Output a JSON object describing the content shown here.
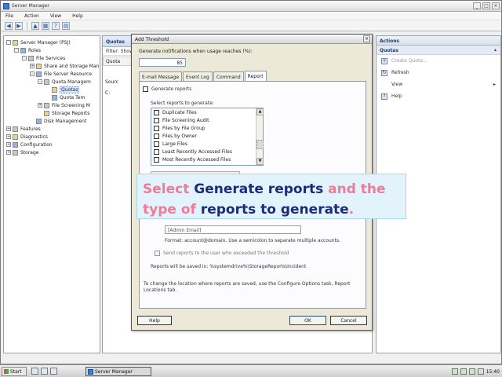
{
  "window": {
    "title": "Server Manager"
  },
  "menu": [
    "File",
    "Action",
    "View",
    "Help"
  ],
  "tree": [
    {
      "label": "Server Manager (PSJ)",
      "depth": 0,
      "exp": "-",
      "icon": "server-icon"
    },
    {
      "label": "Roles",
      "depth": 1,
      "exp": "-",
      "icon": "roles-icon"
    },
    {
      "label": "File Services",
      "depth": 2,
      "exp": "-",
      "icon": "folder-icon"
    },
    {
      "label": "Share and Storage Man",
      "depth": 3,
      "exp": "+",
      "icon": "share-icon"
    },
    {
      "label": "File Server Resource",
      "depth": 3,
      "exp": "-",
      "icon": "fsrm-icon"
    },
    {
      "label": "Quota Managem",
      "depth": 4,
      "exp": "-",
      "icon": "quota-icon"
    },
    {
      "label": "Quotas",
      "depth": 5,
      "exp": "",
      "icon": "quotas-icon",
      "selected": true
    },
    {
      "label": "Quota Tem",
      "depth": 5,
      "exp": "",
      "icon": "template-icon"
    },
    {
      "label": "File Screening M",
      "depth": 4,
      "exp": "+",
      "icon": "screen-icon"
    },
    {
      "label": "Storage Reports",
      "depth": 4,
      "exp": "",
      "icon": "reports-icon"
    },
    {
      "label": "Disk Management",
      "depth": 3,
      "exp": "",
      "icon": "disk-icon"
    },
    {
      "label": "Features",
      "depth": 0,
      "exp": "+",
      "icon": "features-icon"
    },
    {
      "label": "Diagnostics",
      "depth": 0,
      "exp": "+",
      "icon": "diagnostics-icon"
    },
    {
      "label": "Configuration",
      "depth": 0,
      "exp": "+",
      "icon": "configuration-icon"
    },
    {
      "label": "Storage",
      "depth": 0,
      "exp": "+",
      "icon": "storage-icon"
    }
  ],
  "middle": {
    "header": "Quotas",
    "filter": "Filter: Show",
    "col": "Quota",
    "row1": "Sourc",
    "row2": "C:"
  },
  "actions": {
    "header": "Actions",
    "section": "Quotas",
    "items": [
      {
        "label": "Create Quota...",
        "disabled": true
      },
      {
        "label": "Refresh",
        "disabled": false
      },
      {
        "label": "View",
        "disabled": false,
        "submenu": true
      },
      {
        "label": "Help",
        "disabled": false
      }
    ]
  },
  "dialog": {
    "title": "Add Threshold",
    "generate_label": "Generate notifications when usage reaches (%):",
    "percent": "85",
    "tabs": [
      "E-mail Message",
      "Event Log",
      "Command",
      "Report"
    ],
    "active_tab": 3,
    "generate_reports": "Generate reports",
    "select_label": "Select reports to generate:",
    "reports": [
      "Duplicate Files",
      "File Screening Audit",
      "Files by File Group",
      "Files by Owner",
      "Large Files",
      "Least Recently Accessed Files",
      "Most Recently Accessed Files"
    ],
    "email_value": "[Admin Email]",
    "format_note": "Format: account@domain. Use a semicolon to separate multiple accounts.",
    "send_user": "Send reports to the user who exceeded the threshold",
    "saved_note": "Reports will be saved in: %systemdrive%\\StorageReports\\Incident",
    "change_note": "To change the location where reports are saved, use the Configure Options task, Report Locations tab.",
    "help": "Help",
    "ok": "OK",
    "cancel": "Cancel"
  },
  "callout": {
    "w1": "Select",
    "w2": "Generate reports",
    "w3": "and the",
    "w4": "type of",
    "w5": "reports to generate",
    "w6": "."
  },
  "taskbar": {
    "start": "Start",
    "task": "Server Manager",
    "clock": "15:40"
  }
}
